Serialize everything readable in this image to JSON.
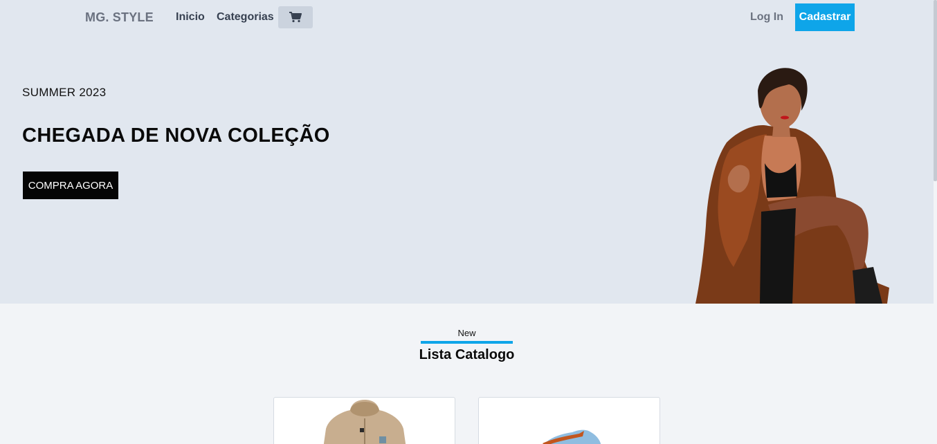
{
  "nav": {
    "brand": "MG. STYLE",
    "links": [
      {
        "label": "Inicio"
      },
      {
        "label": "Categorias"
      }
    ],
    "cart_icon": "cart-icon",
    "login_label": "Log In",
    "signup_label": "Cadastrar"
  },
  "hero": {
    "kicker": "SUMMER 2023",
    "title": "CHEGADA DE NOVA COLEÇÃO",
    "cta_label": "COMPRA AGORA"
  },
  "catalog": {
    "kicker": "New",
    "title": "Lista Catalogo"
  },
  "colors": {
    "accent": "#0ea5e9",
    "header_bg": "#e1e7ef",
    "page_bg": "#f2f4f7",
    "cta_bg": "#050505"
  }
}
